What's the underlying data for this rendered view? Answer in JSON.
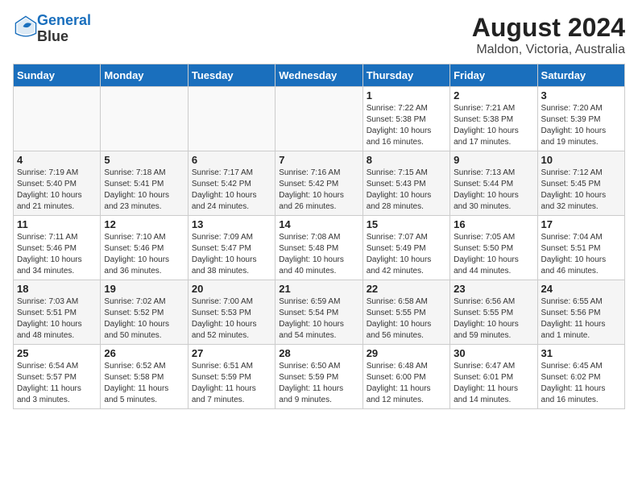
{
  "header": {
    "logo_line1": "General",
    "logo_line2": "Blue",
    "title": "August 2024",
    "subtitle": "Maldon, Victoria, Australia"
  },
  "calendar": {
    "days_of_week": [
      "Sunday",
      "Monday",
      "Tuesday",
      "Wednesday",
      "Thursday",
      "Friday",
      "Saturday"
    ],
    "weeks": [
      [
        {
          "day": "",
          "info": ""
        },
        {
          "day": "",
          "info": ""
        },
        {
          "day": "",
          "info": ""
        },
        {
          "day": "",
          "info": ""
        },
        {
          "day": "1",
          "info": "Sunrise: 7:22 AM\nSunset: 5:38 PM\nDaylight: 10 hours\nand 16 minutes."
        },
        {
          "day": "2",
          "info": "Sunrise: 7:21 AM\nSunset: 5:38 PM\nDaylight: 10 hours\nand 17 minutes."
        },
        {
          "day": "3",
          "info": "Sunrise: 7:20 AM\nSunset: 5:39 PM\nDaylight: 10 hours\nand 19 minutes."
        }
      ],
      [
        {
          "day": "4",
          "info": "Sunrise: 7:19 AM\nSunset: 5:40 PM\nDaylight: 10 hours\nand 21 minutes."
        },
        {
          "day": "5",
          "info": "Sunrise: 7:18 AM\nSunset: 5:41 PM\nDaylight: 10 hours\nand 23 minutes."
        },
        {
          "day": "6",
          "info": "Sunrise: 7:17 AM\nSunset: 5:42 PM\nDaylight: 10 hours\nand 24 minutes."
        },
        {
          "day": "7",
          "info": "Sunrise: 7:16 AM\nSunset: 5:42 PM\nDaylight: 10 hours\nand 26 minutes."
        },
        {
          "day": "8",
          "info": "Sunrise: 7:15 AM\nSunset: 5:43 PM\nDaylight: 10 hours\nand 28 minutes."
        },
        {
          "day": "9",
          "info": "Sunrise: 7:13 AM\nSunset: 5:44 PM\nDaylight: 10 hours\nand 30 minutes."
        },
        {
          "day": "10",
          "info": "Sunrise: 7:12 AM\nSunset: 5:45 PM\nDaylight: 10 hours\nand 32 minutes."
        }
      ],
      [
        {
          "day": "11",
          "info": "Sunrise: 7:11 AM\nSunset: 5:46 PM\nDaylight: 10 hours\nand 34 minutes."
        },
        {
          "day": "12",
          "info": "Sunrise: 7:10 AM\nSunset: 5:46 PM\nDaylight: 10 hours\nand 36 minutes."
        },
        {
          "day": "13",
          "info": "Sunrise: 7:09 AM\nSunset: 5:47 PM\nDaylight: 10 hours\nand 38 minutes."
        },
        {
          "day": "14",
          "info": "Sunrise: 7:08 AM\nSunset: 5:48 PM\nDaylight: 10 hours\nand 40 minutes."
        },
        {
          "day": "15",
          "info": "Sunrise: 7:07 AM\nSunset: 5:49 PM\nDaylight: 10 hours\nand 42 minutes."
        },
        {
          "day": "16",
          "info": "Sunrise: 7:05 AM\nSunset: 5:50 PM\nDaylight: 10 hours\nand 44 minutes."
        },
        {
          "day": "17",
          "info": "Sunrise: 7:04 AM\nSunset: 5:51 PM\nDaylight: 10 hours\nand 46 minutes."
        }
      ],
      [
        {
          "day": "18",
          "info": "Sunrise: 7:03 AM\nSunset: 5:51 PM\nDaylight: 10 hours\nand 48 minutes."
        },
        {
          "day": "19",
          "info": "Sunrise: 7:02 AM\nSunset: 5:52 PM\nDaylight: 10 hours\nand 50 minutes."
        },
        {
          "day": "20",
          "info": "Sunrise: 7:00 AM\nSunset: 5:53 PM\nDaylight: 10 hours\nand 52 minutes."
        },
        {
          "day": "21",
          "info": "Sunrise: 6:59 AM\nSunset: 5:54 PM\nDaylight: 10 hours\nand 54 minutes."
        },
        {
          "day": "22",
          "info": "Sunrise: 6:58 AM\nSunset: 5:55 PM\nDaylight: 10 hours\nand 56 minutes."
        },
        {
          "day": "23",
          "info": "Sunrise: 6:56 AM\nSunset: 5:55 PM\nDaylight: 10 hours\nand 59 minutes."
        },
        {
          "day": "24",
          "info": "Sunrise: 6:55 AM\nSunset: 5:56 PM\nDaylight: 11 hours\nand 1 minute."
        }
      ],
      [
        {
          "day": "25",
          "info": "Sunrise: 6:54 AM\nSunset: 5:57 PM\nDaylight: 11 hours\nand 3 minutes."
        },
        {
          "day": "26",
          "info": "Sunrise: 6:52 AM\nSunset: 5:58 PM\nDaylight: 11 hours\nand 5 minutes."
        },
        {
          "day": "27",
          "info": "Sunrise: 6:51 AM\nSunset: 5:59 PM\nDaylight: 11 hours\nand 7 minutes."
        },
        {
          "day": "28",
          "info": "Sunrise: 6:50 AM\nSunset: 5:59 PM\nDaylight: 11 hours\nand 9 minutes."
        },
        {
          "day": "29",
          "info": "Sunrise: 6:48 AM\nSunset: 6:00 PM\nDaylight: 11 hours\nand 12 minutes."
        },
        {
          "day": "30",
          "info": "Sunrise: 6:47 AM\nSunset: 6:01 PM\nDaylight: 11 hours\nand 14 minutes."
        },
        {
          "day": "31",
          "info": "Sunrise: 6:45 AM\nSunset: 6:02 PM\nDaylight: 11 hours\nand 16 minutes."
        }
      ]
    ]
  }
}
